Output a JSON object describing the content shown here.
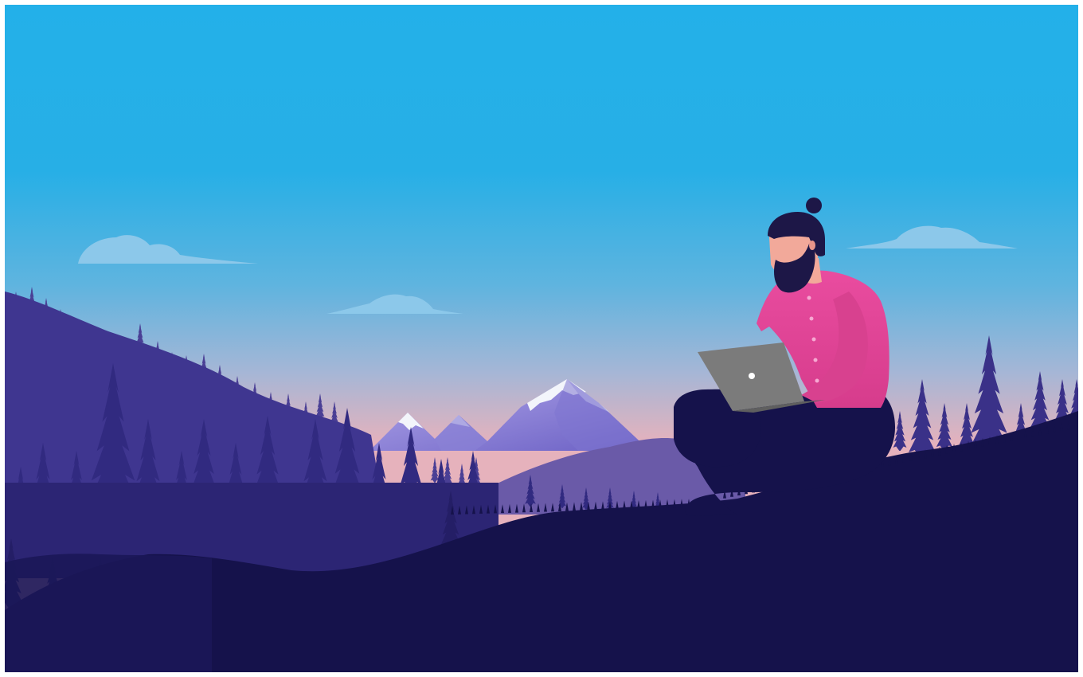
{
  "illustration": {
    "subject": "man-with-laptop-on-hill",
    "colors": {
      "sky_top": "#23b0e9",
      "sky_mid": "#5eb6e0",
      "sky_horizon": "#eab0b8",
      "cloud": "#8cc8ea",
      "snow": "#f3f5fb",
      "mountain_light": "#9a8fe0",
      "mountain_mid": "#6a5fb4",
      "forest_far": "#4a3f95",
      "forest_mid": "#3a3188",
      "forest_near": "#2b2570",
      "ground": "#15124b",
      "shirt": "#e0479a",
      "skin": "#f2a99a",
      "hair": "#1d1747",
      "pants": "#15124b",
      "laptop": "#7b7b7b",
      "laptop_logo": "#ffffff"
    }
  }
}
